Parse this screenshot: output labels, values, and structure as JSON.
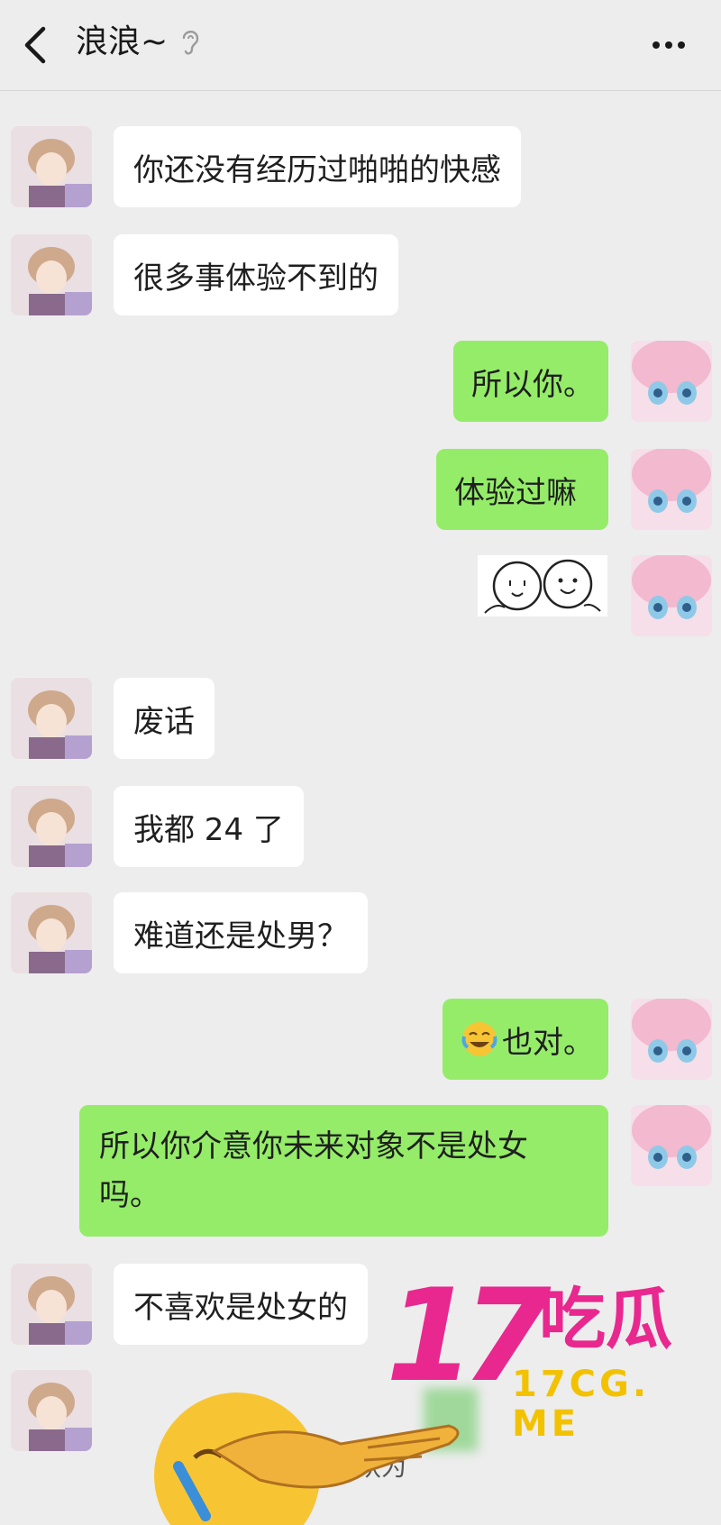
{
  "header": {
    "title": "浪浪~"
  },
  "messages": [
    {
      "side": "in",
      "text": "你还没有经历过啪啪的快感"
    },
    {
      "side": "in",
      "text": "很多事体验不到的"
    },
    {
      "side": "out",
      "text": "所以你。"
    },
    {
      "side": "out",
      "text": "体验过嘛"
    },
    {
      "side": "out",
      "sticker": "two-smiley-faces-sticker"
    },
    {
      "side": "in",
      "text": "废话"
    },
    {
      "side": "in",
      "text": "我都 24 了"
    },
    {
      "side": "in",
      "text": "难道还是处男？"
    },
    {
      "side": "out",
      "text": "也对。",
      "emoji": "laughing-crying-emoji"
    },
    {
      "side": "out",
      "text": "所以你介意你未来对象不是处女吗。"
    },
    {
      "side": "in",
      "text": "不喜欢是处女的"
    }
  ],
  "watermark": {
    "number": "17",
    "chinese": "吃瓜",
    "site": "17CG. ME"
  },
  "partial_text": "认为",
  "colors": {
    "background": "#ededed",
    "incoming_bubble": "#ffffff",
    "outgoing_bubble": "#95ec69",
    "watermark_pink": "#e8288e",
    "watermark_yellow": "#f2c200"
  }
}
